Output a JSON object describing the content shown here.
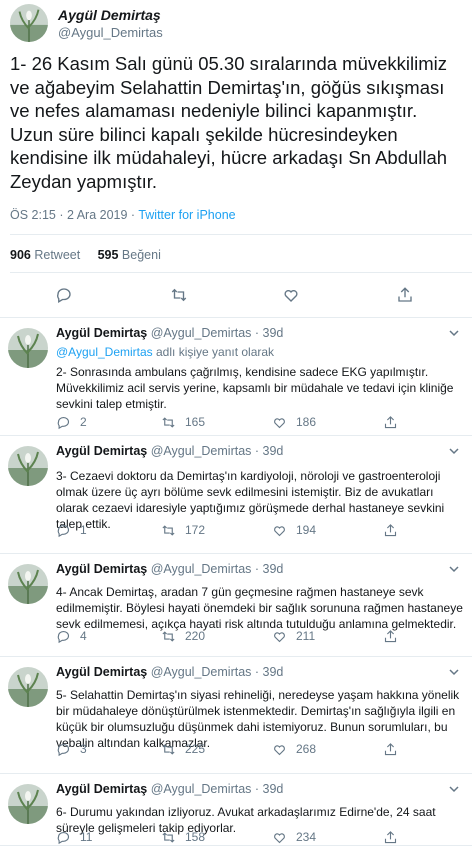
{
  "main_tweet": {
    "author_name": "Aygül Demirtaş",
    "author_handle": "@Aygul_Demirtas",
    "text": "1- 26 Kasım Salı günü 05.30 sıralarında müvekkilimiz ve ağabeyim Selahattin Demirtaş'ın, göğüs sıkışması ve nefes alamaması nedeniyle bilinci kapanmıştır. Uzun süre bilinci kapalı şekilde hücresindeyken kendisine ilk müdahaleyi, hücre arkadaşı Sn Abdullah Zeydan yapmıştır.",
    "timestamp": "ÖS 2:15 · 2 Ara 2019 · ",
    "source": "Twitter for iPhone",
    "retweet_count": "906",
    "retweet_label": "Retweet",
    "like_count": "595",
    "like_label": "Beğeni"
  },
  "icons": {
    "reply": "reply-icon",
    "retweet": "retweet-icon",
    "like": "heart-icon",
    "share": "share-icon",
    "menu": "chevron-down-icon"
  },
  "colors": {
    "link": "#1da1f2",
    "muted": "#657786",
    "text": "#14171a",
    "divider": "#e6ecf0"
  },
  "replies": [
    {
      "name": "Aygül Demirtaş",
      "handle_time": "@Aygul_Demirtas · 39d",
      "replying_handle": "@Aygul_Demirtas",
      "replying_suffix": " adlı kişiye yanıt olarak",
      "text": "2- Sonrasında ambulans çağrılmış, kendisine sadece EKG yapılmıştır. Müvekkilimiz acil servis yerine, kapsamlı bir müdahale ve tedavi için kliniğe sevkini talep etmiştir.",
      "replies": "2",
      "retweets": "165",
      "likes": "186"
    },
    {
      "name": "Aygül Demirtaş",
      "handle_time": "@Aygul_Demirtas · 39d",
      "text": "3- Cezaevi doktoru da Demirtaş'ın kardiyoloji, nöroloji ve gastroenteroloji olmak üzere üç ayrı bölüme sevk edilmesini istemiştir. Biz de avukatları olarak cezaevi idaresiyle yaptığımız görüşmede derhal hastaneye sevkini talep ettik.",
      "replies": "1",
      "retweets": "172",
      "likes": "194"
    },
    {
      "name": "Aygül Demirtaş",
      "handle_time": "@Aygul_Demirtas · 39d",
      "text": "4- Ancak Demirtaş, aradan 7 gün geçmesine rağmen hastaneye sevk edilmemiştir. Böylesi hayati önemdeki bir sağlık sorununa rağmen hastaneye sevk edilmemesi, açıkça hayati risk altında tutulduğu anlamına gelmektedir.",
      "replies": "4",
      "retweets": "220",
      "likes": "211"
    },
    {
      "name": "Aygül Demirtaş",
      "handle_time": "@Aygul_Demirtas · 39d",
      "text": "5- Selahattin Demirtaş'ın siyasi rehineliği, neredeyse yaşam hakkına yönelik bir müdahaleye dönüştürülmek istenmektedir. Demirtaş'ın sağlığıyla ilgili en küçük bir olumsuzluğu düşünmek dahi istemiyoruz. Bunun sorumluları, bu vebalin altından kalkamazlar.",
      "replies": "3",
      "retweets": "225",
      "likes": "268"
    },
    {
      "name": "Aygül Demirtaş",
      "handle_time": "@Aygul_Demirtas · 39d",
      "text": "6- Durumu yakından izliyoruz. Avukat arkadaşlarımız Edirne'de, 24 saat süreyle gelişmeleri takip ediyorlar.",
      "replies": "11",
      "retweets": "158",
      "likes": "234"
    }
  ]
}
